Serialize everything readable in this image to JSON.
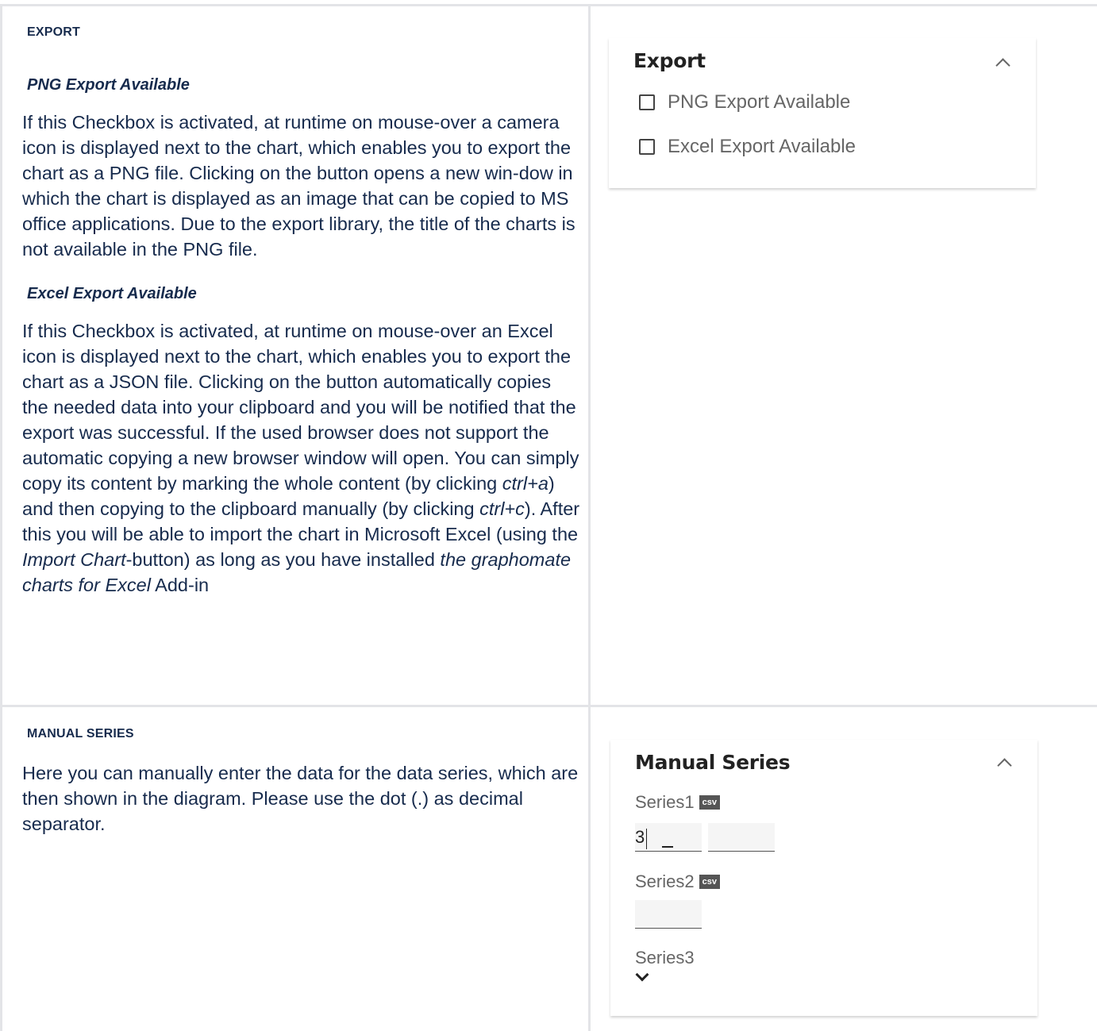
{
  "export_section": {
    "heading": "EXPORT",
    "png": {
      "heading": "PNG Export Available",
      "paragraph": "If this Checkbox is activated, at runtime on mouse-over a camera icon is displayed next to the chart, which enables you to export the chart as a PNG file. Clicking on the button opens a new win-dow in which the chart is displayed as an image that can be copied to MS office applications. Due to the export library, the title of the charts is not available in the PNG file."
    },
    "excel": {
      "heading": "Excel Export Available",
      "p1": "If this Checkbox is activated, at runtime on mouse-over an Excel icon is displayed next to the chart, which enables you to export the chart as a JSON file. Clicking on the button automatically copies the needed data into your clipboard and you will be notified that the export was successful. If the used browser does not support the automatic copying a new browser window will open. You can simply copy its content by marking the whole content (by clicking ",
      "ctrl_a": "ctrl+a",
      "p2": ") and then copying to the clipboard manually (by clicking ",
      "ctrl_c": "ctrl+c",
      "p3": "). After this you will be able to import the chart in Microsoft Excel (using the ",
      "import_chart": "Import Chart",
      "p4": "-button) as long as you have installed ",
      "addin_name": "the graphomate charts for Excel",
      "p5": " Add-in"
    }
  },
  "export_panel": {
    "title": "Export",
    "options": [
      {
        "label": "PNG Export Available",
        "checked": false
      },
      {
        "label": "Excel Export Available",
        "checked": false
      }
    ]
  },
  "manual_section": {
    "heading": "MANUAL SERIES",
    "paragraph": "Here you can manually enter the data for the data series, which are then shown in the diagram. Please use the dot (.) as decimal separator."
  },
  "manual_panel": {
    "title": "Manual Series",
    "series": [
      {
        "label": "Series1",
        "badge": "csv",
        "values": [
          "3",
          ""
        ]
      },
      {
        "label": "Series2",
        "badge": "csv",
        "values": [
          ""
        ]
      },
      {
        "label": "Series3"
      }
    ]
  }
}
